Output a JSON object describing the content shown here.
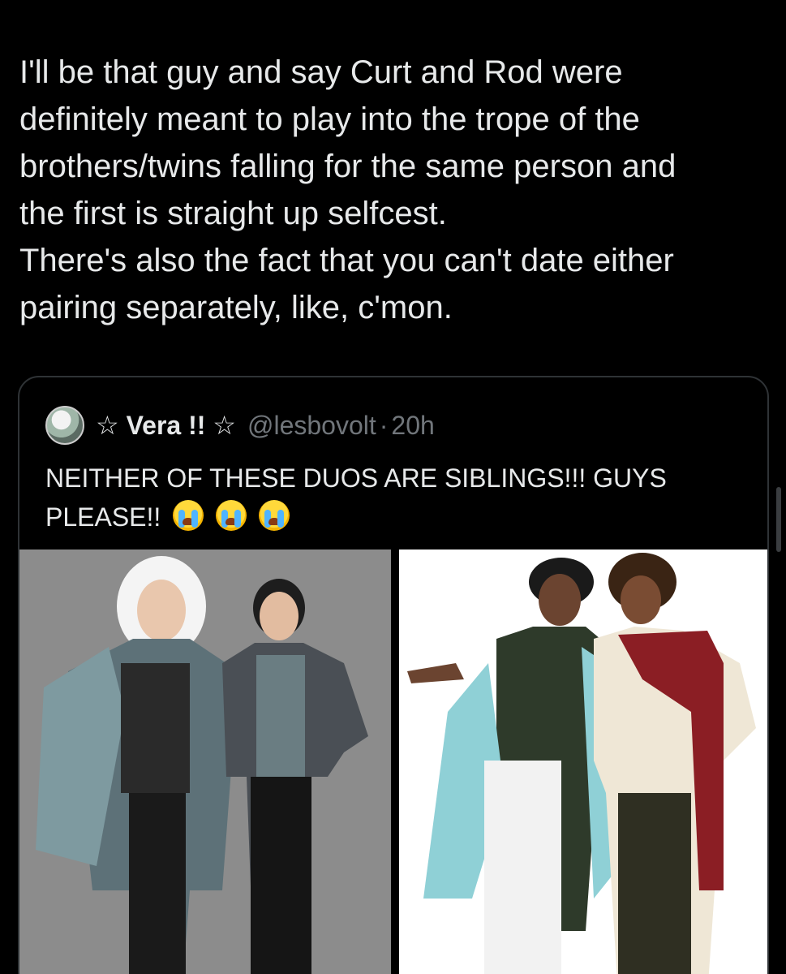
{
  "post": {
    "text": "I'll be that guy and say Curt and Rod were\ndefinitely meant to play into the trope of the\nbrothers/twins falling for the same person and\nthe first is straight up selfcest.\nThere's also the fact that you can't date either\npairing separately, like, c'mon."
  },
  "quote": {
    "avatar_icon": "profile-avatar",
    "display_name": "☆ Vera !! ☆",
    "handle": "@lesbovolt",
    "separator": "·",
    "time": "20h",
    "text": "NEITHER OF THESE DUOS ARE SIBLINGS!!! GUYS PLEASE!!",
    "emoji_name": "loudly-crying-face",
    "emoji_count": 3
  },
  "media": {
    "left_image": "illustration-two-men-grey-background",
    "right_image": "illustration-two-men-white-background"
  },
  "colors": {
    "background": "#000000",
    "text": "#e7e9ea",
    "muted": "#71767b",
    "border": "#2f3336"
  }
}
